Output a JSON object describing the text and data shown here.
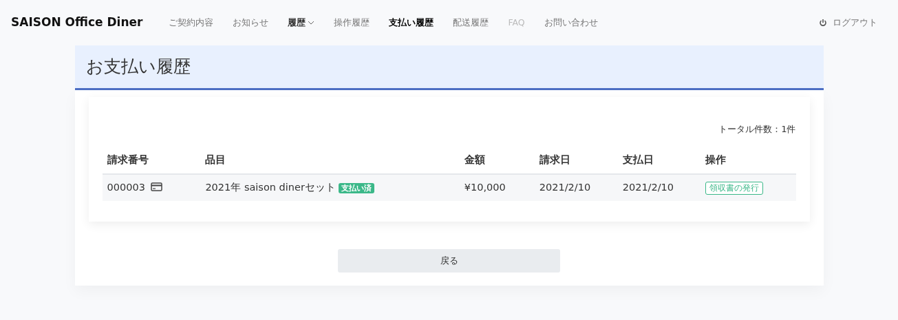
{
  "brand": "SAISON Office Diner",
  "nav": [
    {
      "label": "ご契約内容",
      "selected": false,
      "disabled": false,
      "kind": "link"
    },
    {
      "label": "お知らせ",
      "selected": false,
      "disabled": false,
      "kind": "link"
    },
    {
      "label": "履歴",
      "selected": false,
      "disabled": false,
      "kind": "dropdown"
    },
    {
      "label": "操作履歴",
      "selected": false,
      "disabled": false,
      "kind": "link"
    },
    {
      "label": "支払い履歴",
      "selected": true,
      "disabled": false,
      "kind": "link"
    },
    {
      "label": "配送履歴",
      "selected": false,
      "disabled": false,
      "kind": "link"
    },
    {
      "label": "FAQ",
      "selected": false,
      "disabled": true,
      "kind": "link"
    },
    {
      "label": "お問い合わせ",
      "selected": false,
      "disabled": false,
      "kind": "link"
    }
  ],
  "logout": "ログアウト",
  "page_title": "お支払い履歴",
  "total": "トータル件数：1件",
  "table": {
    "columns": [
      "請求番号",
      "品目",
      "金額",
      "請求日",
      "支払日",
      "操作"
    ],
    "rows": [
      {
        "number": "000003",
        "item": "2021年 saison dinerセット",
        "status": "支払い済",
        "amount": "¥10,000",
        "billed": "2021/2/10",
        "paid": "2021/2/10",
        "action": "領収書の発行"
      }
    ]
  },
  "back_button": "戻る"
}
